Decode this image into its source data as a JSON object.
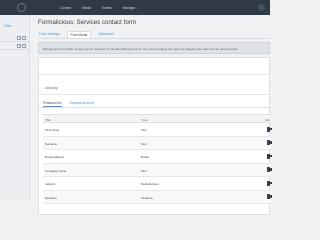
{
  "topnav": {
    "items": [
      "Content",
      "Media",
      "Entries",
      "Manage"
    ]
  },
  "sidebar": {
    "title": "Files"
  },
  "page": {
    "title": "Formalicious: Services contact form"
  },
  "tabs": [
    {
      "label": "Form settings"
    },
    {
      "label": "Form fields"
    },
    {
      "label": "Advanced"
    }
  ],
  "notice": "Manage the form fields. A step can be renamed by double-clicking the text. You can rearrange the steps by dragging the tabs into the desired order.",
  "panel": {
    "add_step": "Add step",
    "subtabs": [
      {
        "label": "Personal info"
      },
      {
        "label": "Request services"
      }
    ]
  },
  "table": {
    "headers": [
      "Title",
      "Type",
      "Acti"
    ],
    "rows": [
      {
        "title": "First name",
        "type": "Text"
      },
      {
        "title": "Surname",
        "type": "Text"
      },
      {
        "title": "Email address",
        "type": "Email"
      },
      {
        "title": "Company name",
        "type": "Text"
      },
      {
        "title": "Industry",
        "type": "Radiobuttons"
      },
      {
        "title": "Question",
        "type": "Textarea"
      }
    ]
  }
}
